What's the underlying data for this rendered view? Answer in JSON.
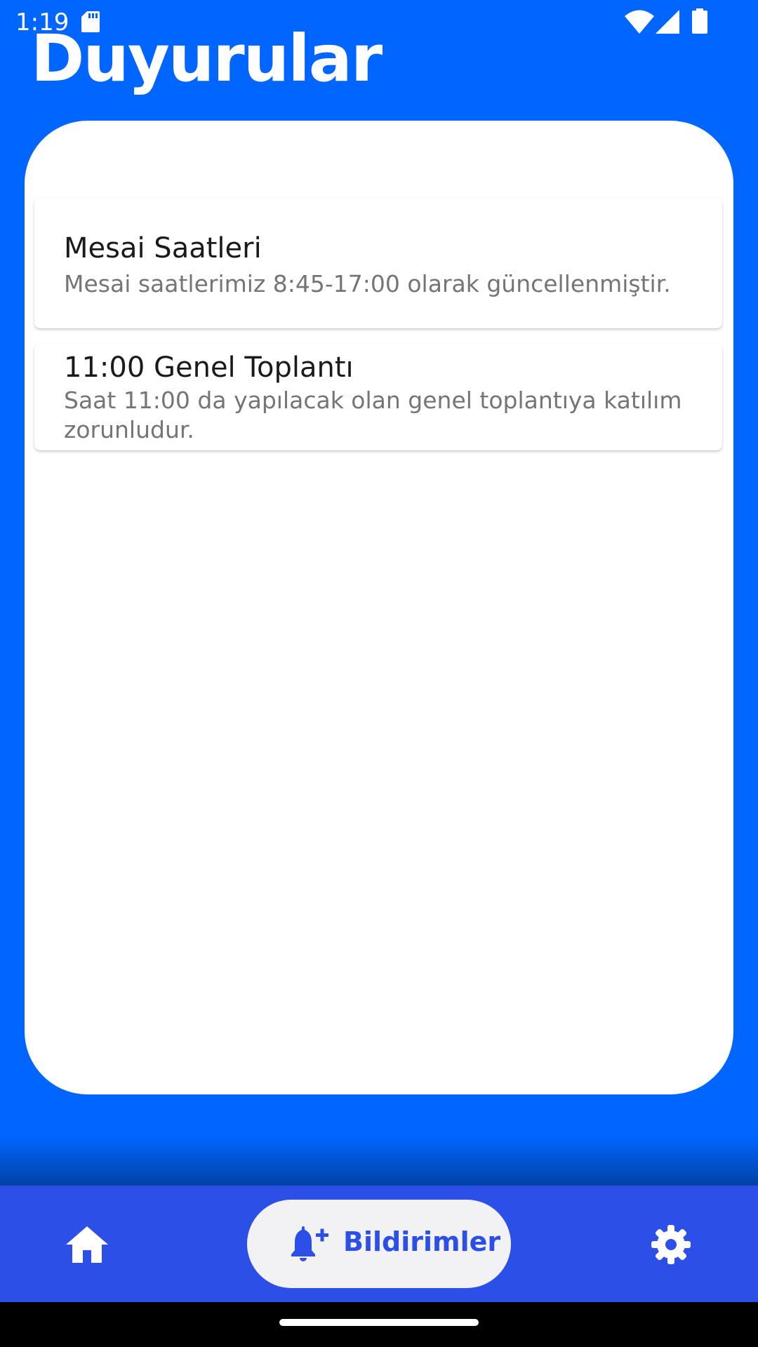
{
  "status_bar": {
    "time": "1:19",
    "icons": [
      "sd-card-icon",
      "wifi-icon",
      "signal-icon",
      "battery-icon"
    ]
  },
  "header": {
    "title": "Duyurular"
  },
  "announcements": [
    {
      "title": "Mesai Saatleri",
      "body": "Mesai saatlerimiz 8:45-17:00 olarak güncellenmiştir."
    },
    {
      "title": "11:00 Genel Toplantı",
      "body_line1": "Saat 11:00 da yapılacak olan genel toplantıya katılım",
      "body_line2": "zorunludur."
    }
  ],
  "bottom_nav": {
    "home_icon": "home-icon",
    "active_label": "Bildirimler",
    "active_icon": "bell-plus-icon",
    "settings_icon": "gear-icon"
  },
  "colors": {
    "background": "#0066ff",
    "nav_bar": "#2c4fe8",
    "active_pill": "#f2f2f4",
    "card": "#ffffff"
  }
}
